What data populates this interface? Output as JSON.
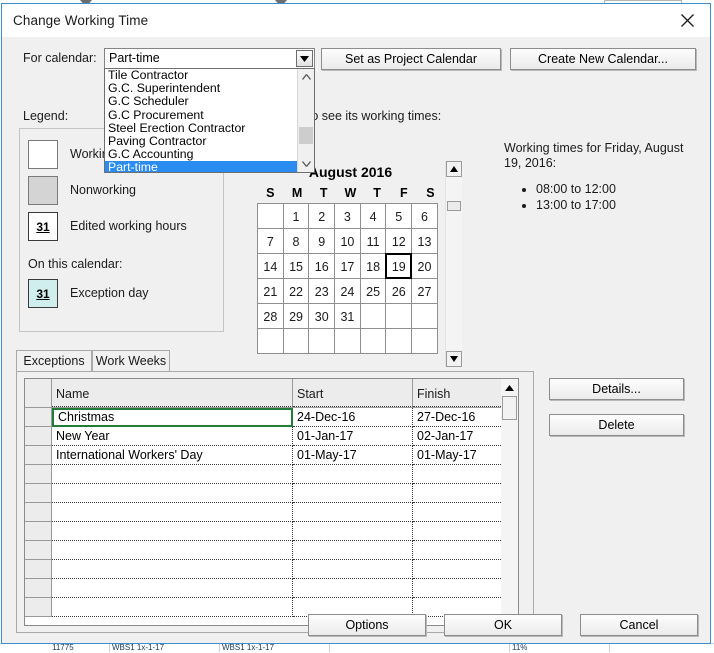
{
  "dialog": {
    "title": "Change Working Time",
    "close_icon": "close-icon"
  },
  "calendar_selector": {
    "label": "For calendar:",
    "value": "Part-time",
    "options": [
      "Tile Contractor",
      "G.C. Superintendent",
      "G.C Scheduler",
      "G.C Procurement",
      "Steel Erection Contractor",
      "Paving Contractor",
      "G.C Accounting",
      "Part-time"
    ],
    "selected_option": "Part-time",
    "set_as_project_calendar": "Set as Project Calendar",
    "create_new_calendar": "Create New Calendar..."
  },
  "legend": {
    "label": "Legend:",
    "items": [
      {
        "swatch": "working",
        "text": "Working",
        "glyph": ""
      },
      {
        "swatch": "nonworking",
        "text": "Nonworking",
        "glyph": ""
      },
      {
        "swatch": "edited",
        "text": "Edited working hours",
        "glyph": "31"
      }
    ],
    "on_this_calendar_label": "On this calendar:",
    "calendar_items": [
      {
        "swatch": "exception",
        "text": "Exception day",
        "glyph": "31"
      }
    ]
  },
  "calendar": {
    "hint": "ate to see its working times:",
    "month_title": "August 2016",
    "day_headers": [
      "S",
      "M",
      "T",
      "W",
      "T",
      "F",
      "S"
    ],
    "weeks": [
      [
        {
          "day": "",
          "nonworking": false,
          "selected": false
        },
        {
          "day": "1",
          "nonworking": false,
          "selected": false
        },
        {
          "day": "2",
          "nonworking": false,
          "selected": false
        },
        {
          "day": "3",
          "nonworking": false,
          "selected": false
        },
        {
          "day": "4",
          "nonworking": false,
          "selected": false
        },
        {
          "day": "5",
          "nonworking": false,
          "selected": false
        },
        {
          "day": "6",
          "nonworking": true,
          "selected": false
        }
      ],
      [
        {
          "day": "7",
          "nonworking": true,
          "selected": false
        },
        {
          "day": "8",
          "nonworking": false,
          "selected": false
        },
        {
          "day": "9",
          "nonworking": false,
          "selected": false
        },
        {
          "day": "10",
          "nonworking": false,
          "selected": false
        },
        {
          "day": "11",
          "nonworking": false,
          "selected": false
        },
        {
          "day": "12",
          "nonworking": false,
          "selected": false
        },
        {
          "day": "13",
          "nonworking": true,
          "selected": false
        }
      ],
      [
        {
          "day": "14",
          "nonworking": true,
          "selected": false
        },
        {
          "day": "15",
          "nonworking": false,
          "selected": false
        },
        {
          "day": "16",
          "nonworking": false,
          "selected": false
        },
        {
          "day": "17",
          "nonworking": false,
          "selected": false
        },
        {
          "day": "18",
          "nonworking": false,
          "selected": false
        },
        {
          "day": "19",
          "nonworking": false,
          "selected": true
        },
        {
          "day": "20",
          "nonworking": true,
          "selected": false
        }
      ],
      [
        {
          "day": "21",
          "nonworking": true,
          "selected": false
        },
        {
          "day": "22",
          "nonworking": false,
          "selected": false
        },
        {
          "day": "23",
          "nonworking": false,
          "selected": false
        },
        {
          "day": "24",
          "nonworking": false,
          "selected": false
        },
        {
          "day": "25",
          "nonworking": false,
          "selected": false
        },
        {
          "day": "26",
          "nonworking": false,
          "selected": false
        },
        {
          "day": "27",
          "nonworking": true,
          "selected": false
        }
      ],
      [
        {
          "day": "28",
          "nonworking": true,
          "selected": false
        },
        {
          "day": "29",
          "nonworking": false,
          "selected": false
        },
        {
          "day": "30",
          "nonworking": false,
          "selected": false
        },
        {
          "day": "31",
          "nonworking": false,
          "selected": false
        },
        {
          "day": "",
          "nonworking": false,
          "selected": false
        },
        {
          "day": "",
          "nonworking": false,
          "selected": false
        },
        {
          "day": "",
          "nonworking": false,
          "selected": false
        }
      ],
      [
        {
          "day": "",
          "nonworking": false,
          "selected": false
        },
        {
          "day": "",
          "nonworking": false,
          "selected": false
        },
        {
          "day": "",
          "nonworking": false,
          "selected": false
        },
        {
          "day": "",
          "nonworking": false,
          "selected": false
        },
        {
          "day": "",
          "nonworking": false,
          "selected": false
        },
        {
          "day": "",
          "nonworking": false,
          "selected": false
        },
        {
          "day": "",
          "nonworking": false,
          "selected": false
        }
      ]
    ]
  },
  "working_times": {
    "title": "Working times for Friday, August 19, 2016:",
    "entries": [
      "08:00 to 12:00",
      "13:00 to 17:00"
    ]
  },
  "tabs": [
    {
      "label": "Exceptions",
      "active": true
    },
    {
      "label": "Work Weeks",
      "active": false
    }
  ],
  "exceptions_grid": {
    "columns": [
      "Name",
      "Start",
      "Finish"
    ],
    "rows": [
      {
        "name": "Christmas",
        "start": "24-Dec-16",
        "finish": "27-Dec-16",
        "selected": true
      },
      {
        "name": "New Year",
        "start": "01-Jan-17",
        "finish": "02-Jan-17",
        "selected": false
      },
      {
        "name": "International Workers' Day",
        "start": "01-May-17",
        "finish": "01-May-17",
        "selected": false
      },
      {
        "name": "",
        "start": "",
        "finish": "",
        "selected": false
      },
      {
        "name": "",
        "start": "",
        "finish": "",
        "selected": false
      },
      {
        "name": "",
        "start": "",
        "finish": "",
        "selected": false
      },
      {
        "name": "",
        "start": "",
        "finish": "",
        "selected": false
      },
      {
        "name": "",
        "start": "",
        "finish": "",
        "selected": false
      },
      {
        "name": "",
        "start": "",
        "finish": "",
        "selected": false
      },
      {
        "name": "",
        "start": "",
        "finish": "",
        "selected": false
      },
      {
        "name": "",
        "start": "",
        "finish": "",
        "selected": false
      }
    ]
  },
  "side_buttons": {
    "details": "Details...",
    "delete": "Delete"
  },
  "footer_buttons": {
    "options": "Options",
    "ok": "OK",
    "cancel": "Cancel"
  },
  "background": {
    "cells": [
      "11775",
      "WBS1 1x-1-17",
      "WBS1 1x-1-17",
      "",
      "11%"
    ]
  },
  "colors": {
    "dialog_border": "#3b8ed0",
    "dialog_bg": "#f0f0f0",
    "selection_blue": "#2a8cf0",
    "cell_selection_green": "#237b39",
    "nonworking_gray": "#d4d4d4",
    "exception_cyan": "#cfeeed"
  }
}
